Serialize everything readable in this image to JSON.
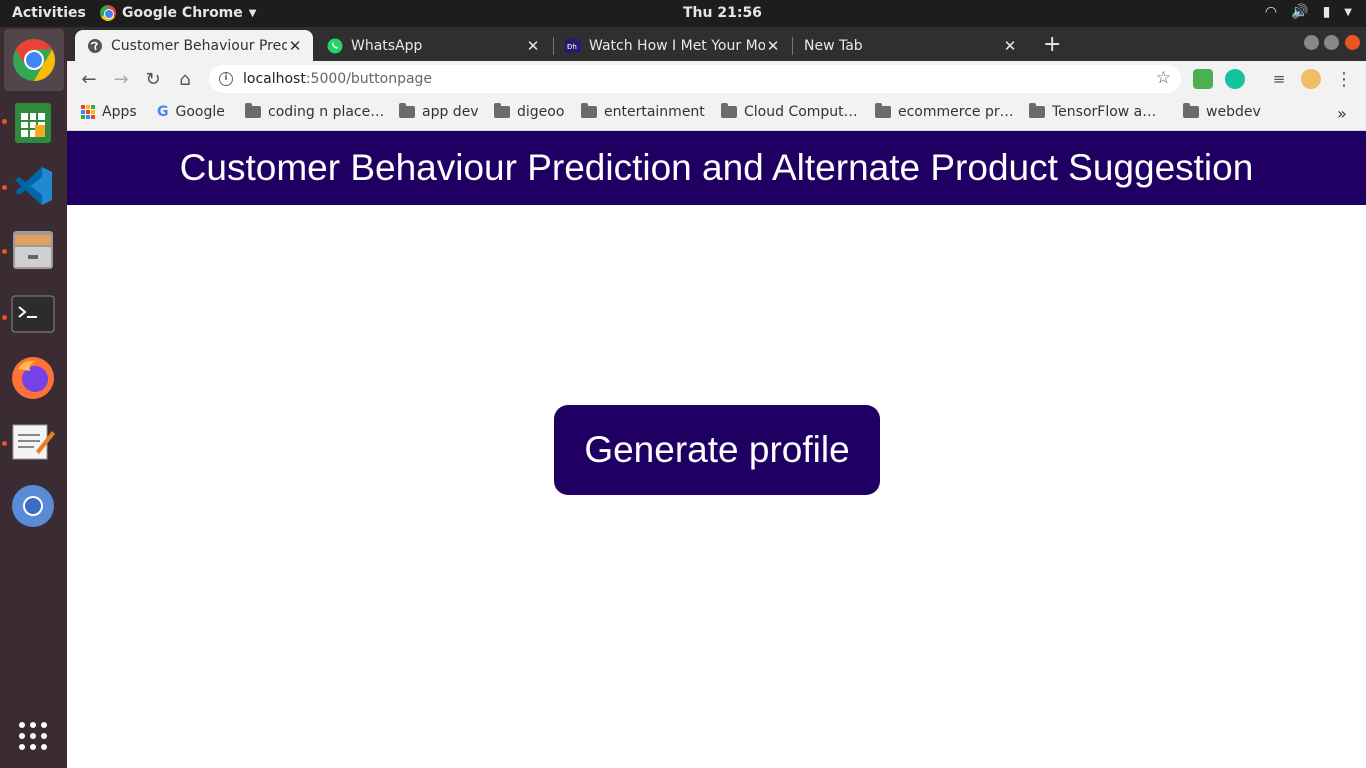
{
  "system": {
    "activities": "Activities",
    "app_name": "Google Chrome",
    "clock": "Thu 21:56"
  },
  "tabs": [
    {
      "title": "Customer Behaviour Pred",
      "icon": "globe-icon",
      "active": true
    },
    {
      "title": "WhatsApp",
      "icon": "whatsapp-icon",
      "active": false
    },
    {
      "title": "Watch How I Met Your Mo",
      "icon": "dh-icon",
      "active": false
    },
    {
      "title": "New Tab",
      "icon": "",
      "active": false
    }
  ],
  "omnibox": {
    "host": "localhost",
    "path": ":5000/buttonpage"
  },
  "bookmarks": [
    {
      "label": "Apps",
      "icon": "apps-grid-icon"
    },
    {
      "label": "Google",
      "icon": "google-icon"
    },
    {
      "label": "coding n place…",
      "icon": "folder-icon"
    },
    {
      "label": "app dev",
      "icon": "folder-icon"
    },
    {
      "label": "digeoo",
      "icon": "folder-icon"
    },
    {
      "label": "entertainment",
      "icon": "folder-icon"
    },
    {
      "label": "Cloud Comput…",
      "icon": "folder-icon"
    },
    {
      "label": "ecommerce pr…",
      "icon": "folder-icon"
    },
    {
      "label": "TensorFlow a…",
      "icon": "folder-icon"
    },
    {
      "label": "webdev",
      "icon": "folder-icon"
    }
  ],
  "page": {
    "heading": "Customer Behaviour Prediction and Alternate Product Suggestion",
    "button_label": "Generate profile"
  },
  "colors": {
    "brand": "#1f0062",
    "dock": "#3b2c34",
    "accent_dot": "#e95420"
  }
}
